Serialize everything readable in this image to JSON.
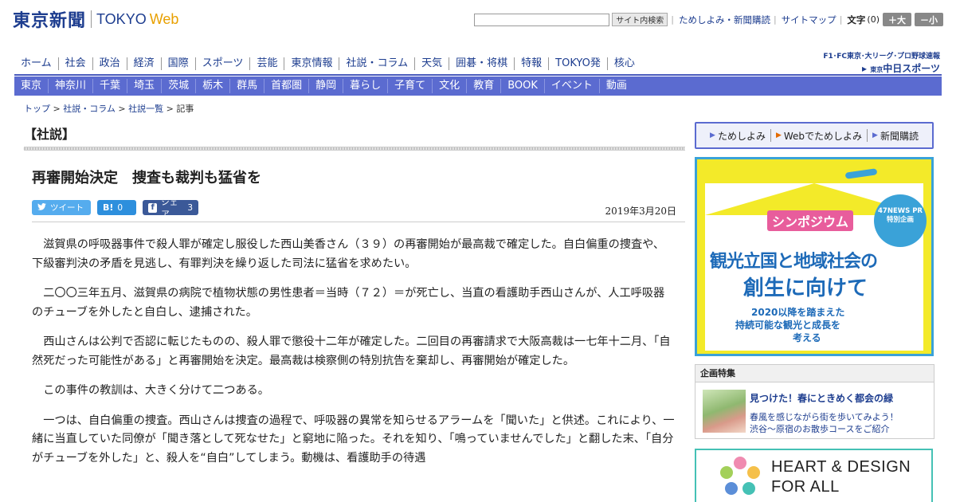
{
  "header": {
    "logo_jp": "東京新聞",
    "logo_tokyo": "TOKYO",
    "logo_web": "Web",
    "search_placeholder": "",
    "search_button": "サイト内検索",
    "links": [
      "ためしよみ・新聞購読",
      "サイトマップ"
    ],
    "fontsize_label": "文字",
    "fontsize_value": "(0)",
    "fontsize_plus": "＋大",
    "fontsize_minus": "－小"
  },
  "main_nav": [
    "ホーム",
    "社会",
    "政治",
    "経済",
    "国際",
    "スポーツ",
    "芸能",
    "東京情報",
    "社説・コラム",
    "天気",
    "囲碁・将棋",
    "特報",
    "TOKYO発",
    "核心"
  ],
  "chunichi": {
    "line1": "F1･FC東京･大リーグ･プロ野球速報",
    "line2_prefix": "東京",
    "line2": "中日スポーツ"
  },
  "sub_nav": [
    "東京",
    "神奈川",
    "千葉",
    "埼玉",
    "茨城",
    "栃木",
    "群馬",
    "首都圏",
    "静岡",
    "暮らし",
    "子育て",
    "文化",
    "教育",
    "BOOK",
    "イベント",
    "動画"
  ],
  "breadcrumb": {
    "items": [
      "トップ",
      "社説・コラム",
      "社説一覧"
    ],
    "current": "記事",
    "separator": " > "
  },
  "article": {
    "section": "【社説】",
    "headline": "再審開始決定　捜査も裁判も猛省を",
    "date": "2019年3月20日",
    "social": {
      "tweet_icon": "twitter-icon",
      "tweet": "ツイート",
      "hatena_icon": "B!",
      "hatena_count": "0",
      "share_icon": "f",
      "share_label": "シェア",
      "share_count": "3"
    },
    "paragraphs": [
      "滋賀県の呼吸器事件で殺人罪が確定し服役した西山美香さん（３９）の再審開始が最高裁で確定した。自白偏重の捜査や、下級審判決の矛盾を見逃し、有罪判決を繰り返した司法に猛省を求めたい。",
      "二〇〇三年五月、滋賀県の病院で植物状態の男性患者＝当時（７２）＝が死亡し、当直の看護助手西山さんが、人工呼吸器のチューブを外したと自白し、逮捕された。",
      "西山さんは公判で否認に転じたものの、殺人罪で懲役十二年が確定した。二回目の再審請求で大阪高裁は一七年十二月、「自然死だった可能性がある」と再審開始を決定。最高裁は検察側の特別抗告を棄却し、再審開始が確定した。",
      "この事件の教訓は、大きく分けて二つある。",
      "一つは、自白偏重の捜査。西山さんは捜査の過程で、呼吸器の異常を知らせるアラームを「聞いた」と供述。これにより、一緒に当直していた同僚が「聞き落として死なせた」と窮地に陥った。それを知り、「鳴っていませんでした」と翻した末、「自分がチューブを外した」と、殺人を“自白”してしまう。動機は、看護助手の待遇"
    ]
  },
  "sidebar": {
    "subscribe": [
      "ためしよみ",
      "Webでためしよみ",
      "新聞購読"
    ],
    "ad": {
      "symposium": "シンポジウム",
      "badge": "47NEWS PR 特別企画",
      "title1": "観光立国と地域社会の",
      "title2": "創生に向けて",
      "sub1": "2020以降を踏まえた",
      "sub2": "持続可能な観光と成長を",
      "sub3": "考える"
    },
    "feature": {
      "header": "企画特集",
      "title": "見つけた！春にときめく都会の緑",
      "desc1": "春風を感じながら街を歩いてみよう！",
      "desc2": "渋谷～原宿のお散歩コースをご紹介"
    },
    "heart_design": {
      "line1": "HEART & DESIGN",
      "line2": "FOR ALL"
    }
  },
  "colors": {
    "brand_blue": "#1d3d8f",
    "subnav_bg": "#5b6bd0",
    "twitter": "#55acee",
    "hatena": "#2d8fdd",
    "facebook": "#3b5998",
    "ad_yellow": "#f3ea29",
    "ad_blue": "#3aa2d8"
  }
}
